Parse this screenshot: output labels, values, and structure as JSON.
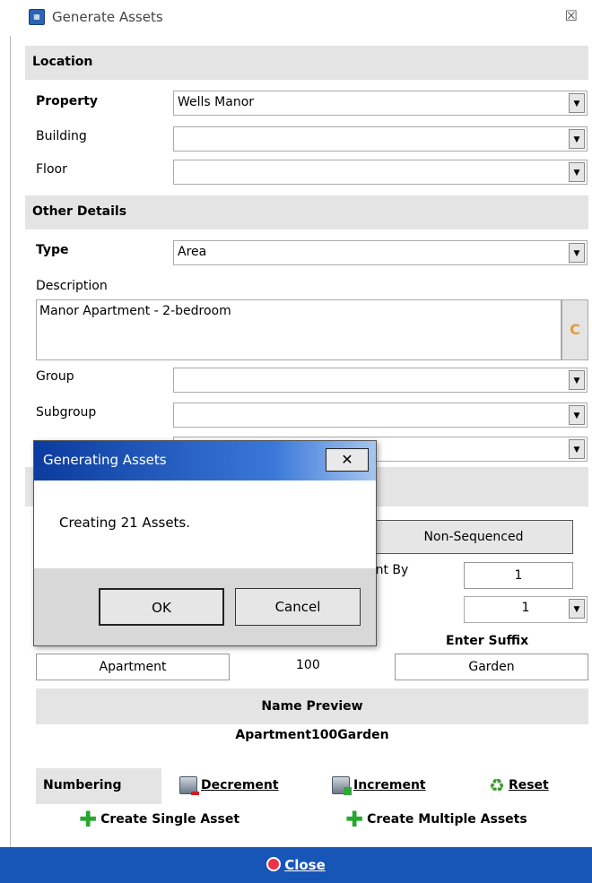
{
  "window": {
    "title": "Generate Assets",
    "close_glyph": "☒"
  },
  "location": {
    "header": "Location",
    "property": {
      "label": "Property",
      "value": "Wells Manor"
    },
    "building": {
      "label": "Building",
      "value": ""
    },
    "floor": {
      "label": "Floor",
      "value": ""
    }
  },
  "other_details": {
    "header": "Other Details",
    "type": {
      "label": "Type",
      "value": "Area"
    },
    "description": {
      "label": "Description",
      "value": "Manor Apartment - 2-bedroom",
      "button": "C"
    },
    "group": {
      "label": "Group",
      "value": ""
    },
    "subgroup": {
      "label": "Subgroup",
      "value": ""
    },
    "hidden_row": {
      "value": ""
    }
  },
  "sequencing": {
    "non_sequenced_label": "Non-Sequenced",
    "increment_label": "ent By",
    "increment_value": "1",
    "start_value": "1",
    "enter_suffix_label": "Enter Suffix",
    "prefix_value": "Apartment",
    "number_value": "100",
    "suffix_value": "Garden"
  },
  "preview": {
    "header": "Name Preview",
    "value": "Apartment100Garden"
  },
  "numbering": {
    "label": "Numbering",
    "decrement_label": "Decrement",
    "increment_label": "Increment",
    "reset_label": "Reset"
  },
  "create": {
    "single_label": "Create Single Asset",
    "multiple_label": "Create Multiple Assets"
  },
  "footer": {
    "close_label": "Close"
  },
  "dialog": {
    "title": "Generating Assets",
    "message": "Creating 21 Assets.",
    "ok_label": "OK",
    "cancel_label": "Cancel"
  },
  "colors": {
    "footer_blue": "#1755b6",
    "accent_orange": "#e59b37",
    "green": "#26a830"
  }
}
